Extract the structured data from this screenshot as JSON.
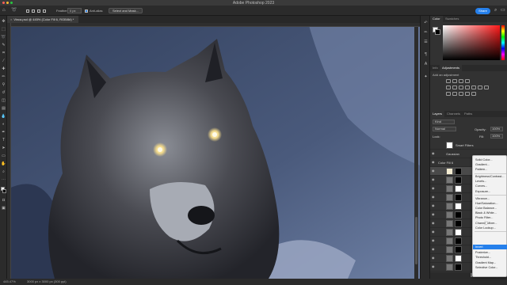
{
  "app": {
    "title": "Adobe Photoshop 2023"
  },
  "colors": {
    "accent": "#2680eb",
    "menu_bg": "#f2f2f2",
    "panel_bg": "#323232"
  },
  "options_bar": {
    "feather_label": "Feather:",
    "feather_value": "0 px",
    "antialias_label": "Anti-alias",
    "select_mask_label": "Select and Mask...",
    "share_label": "Share"
  },
  "document": {
    "tab_title": "Vinca.psd @ 445% (Color Fill 6, RGB/8#) *"
  },
  "status": {
    "zoom": "445.47%",
    "doc_size": "3000 px x 3000 px (300 ppi)"
  },
  "color_panel": {
    "tabs": [
      "Color",
      "Swatches"
    ]
  },
  "info_panel": {
    "tabs": [
      "Info",
      "Adjustments"
    ],
    "add_label": "Add an adjustment"
  },
  "layers_panel": {
    "tabs": [
      "Layers",
      "Channels",
      "Paths"
    ],
    "kind_label": "Kind",
    "blend_mode": "Normal",
    "opacity_label": "Opacity:",
    "opacity_value": "100%",
    "lock_label": "Lock:",
    "fill_label": "Fill:",
    "fill_value": "100%",
    "smart_filters_label": "Smart Filters",
    "gaussian_label": "Gaussian",
    "layer_label": "Color Fill 6"
  },
  "adjustment_menu": {
    "items": [
      "Solid Color...",
      "Gradient...",
      "Pattern...",
      "Brightness/Contrast...",
      "Levels...",
      "Curves...",
      "Exposure...",
      "Vibrance...",
      "Hue/Saturation...",
      "Color Balance...",
      "Black & White...",
      "Photo Filter...",
      "Channel Mixer...",
      "Color Lookup...",
      "Invert",
      "Posterize...",
      "Threshold...",
      "Gradient Map...",
      "Selective Color..."
    ],
    "highlighted": "Invert"
  }
}
